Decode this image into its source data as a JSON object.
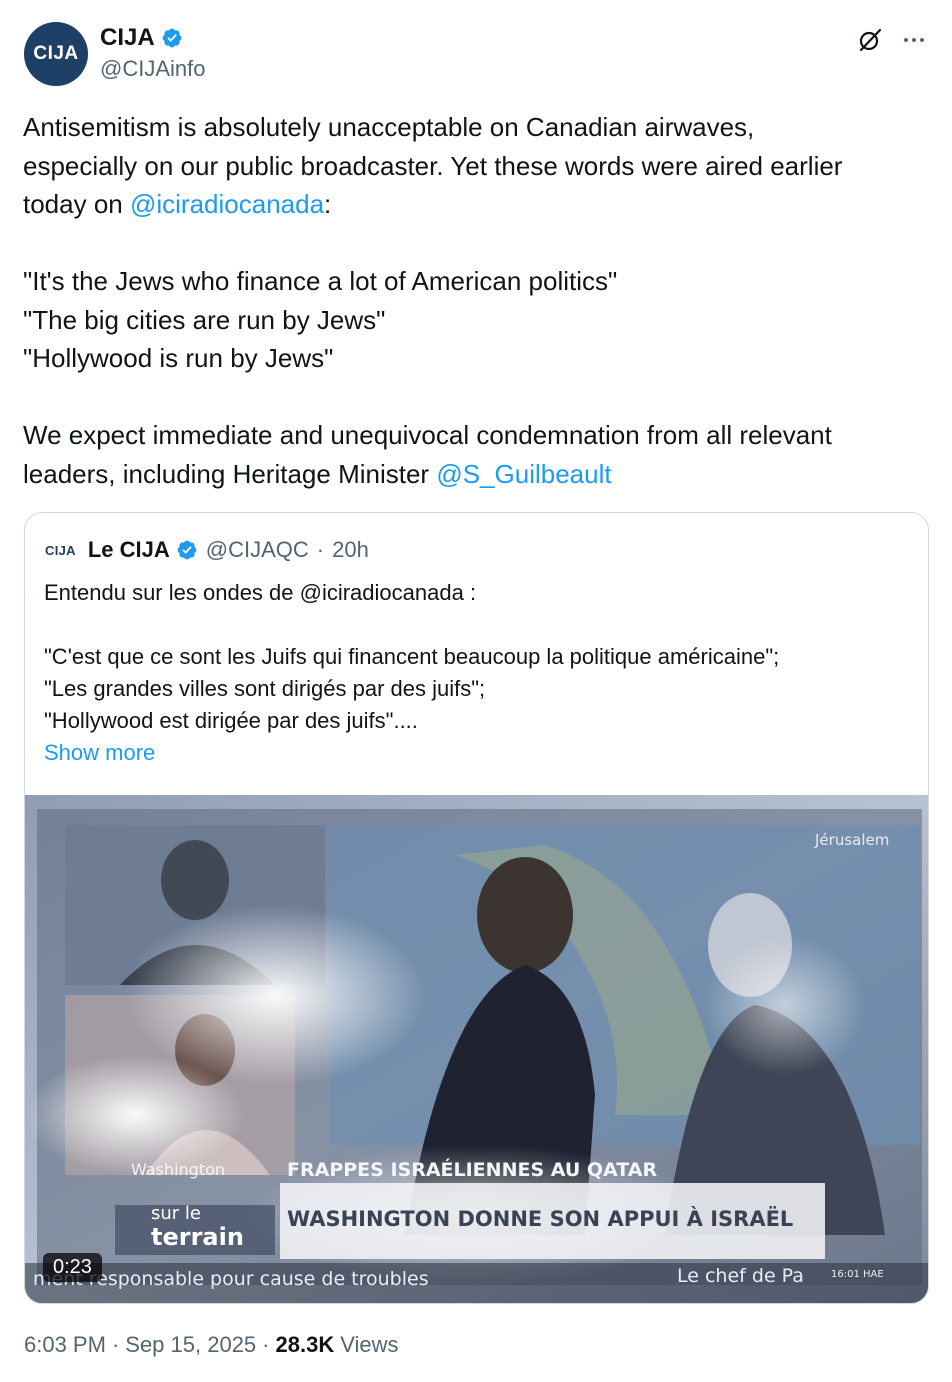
{
  "author": {
    "avatar_text": "CIJA",
    "display_name": "CIJA",
    "handle": "@CIJAinfo"
  },
  "tweet": {
    "line1": "Antisemitism is absolutely unacceptable on Canadian airwaves,",
    "line2": "especially on our public broadcaster. Yet these words were aired earlier",
    "line3_prefix": "today on ",
    "line3_mention": "@iciradiocanada",
    "line3_suffix": ":",
    "quote1": "\"It's the Jews who finance a lot of American politics\"",
    "quote2": "\"The big cities are run by Jews\"",
    "quote3": "\"Hollywood is run by Jews\"",
    "para3_line1": "We expect immediate and unequivocal condemnation from all relevant",
    "para3_line2_prefix": "leaders, including Heritage Minister ",
    "para3_mention": "@S_Guilbeault"
  },
  "quoted": {
    "logo_text": "CIJA",
    "display_name": "Le CIJA",
    "handle": "@CIJAQC",
    "separator": "·",
    "time": "20h",
    "line1": "Entendu sur les ondes de @iciradiocanada :",
    "line2": "\"C'est que ce sont les Juifs qui financent beaucoup la politique américaine\";",
    "line3": "\"Les grandes villes sont dirigés par des juifs\";",
    "line4": "\"Hollywood est dirigée par des juifs\"....",
    "show_more": "Show more",
    "video": {
      "duration": "0:23",
      "overlay_location": "Jérusalem",
      "overlay_washington": "Washington",
      "overlay_sur_le": "sur le",
      "overlay_terrain": "terrain",
      "headline_top": "FRAPPES ISRAÉLIENNES AU QATAR",
      "headline_main": "WASHINGTON DONNE SON APPUI À ISRAËL",
      "ticker": "ment responsable pour cause de troubles",
      "ticker_right": "Le chef de Pa",
      "clock": "16:01 HAE"
    }
  },
  "footer": {
    "time": "6:03 PM",
    "dot1": "·",
    "date": "Sep 15, 2025",
    "dot2": "·",
    "views_count": "28.3K",
    "views_label": "Views"
  },
  "colors": {
    "link": "#1d9bf0",
    "secondary_text": "#536471",
    "verified": "#1d9bf0"
  }
}
